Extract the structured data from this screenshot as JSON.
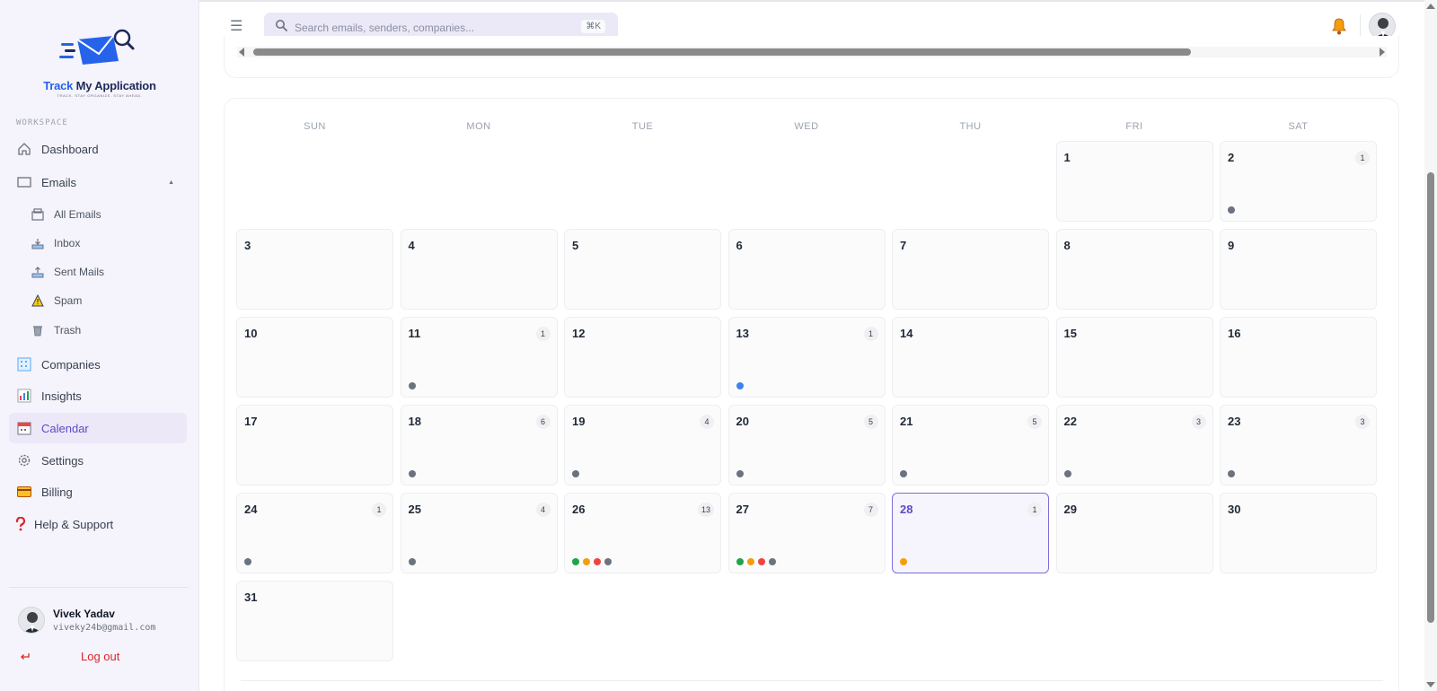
{
  "app": {
    "logo_word_1": "Track",
    "logo_word_2": "My Application",
    "tagline": "TRACK. STAY ORGANIZE. STAY AHEAD."
  },
  "sidebar": {
    "section_label": "WORKSPACE",
    "items": [
      {
        "label": "Dashboard",
        "icon": "home-icon"
      },
      {
        "label": "Emails",
        "icon": "mail-icon"
      },
      {
        "label": "Companies",
        "icon": "building-icon"
      },
      {
        "label": "Insights",
        "icon": "bar-chart-icon"
      },
      {
        "label": "Calendar",
        "icon": "calendar-icon",
        "active": true
      },
      {
        "label": "Settings",
        "icon": "gear-icon"
      },
      {
        "label": "Billing",
        "icon": "credit-card-icon"
      },
      {
        "label": "Help & Support",
        "icon": "question-icon"
      }
    ],
    "email_subitems": [
      {
        "label": "All Emails",
        "icon": "inbox-tray-icon"
      },
      {
        "label": "Inbox",
        "icon": "inbox-icon"
      },
      {
        "label": "Sent Mails",
        "icon": "outbox-icon"
      },
      {
        "label": "Spam",
        "icon": "warning-icon"
      },
      {
        "label": "Trash",
        "icon": "trash-icon"
      }
    ],
    "user": {
      "name": "Vivek Yadav",
      "email": "viveky24b@gmail.com"
    },
    "logout_label": "Log out"
  },
  "header": {
    "search_placeholder": "Search emails, senders, companies...",
    "shortcut": "⌘K"
  },
  "calendar": {
    "weekdays": [
      "SUN",
      "MON",
      "TUE",
      "WED",
      "THU",
      "FRI",
      "SAT"
    ],
    "first_weekday_index": 5,
    "today": 28,
    "days": [
      {
        "day": 1
      },
      {
        "day": 2,
        "count": "1",
        "dots": [
          "#6b7280"
        ]
      },
      {
        "day": 3
      },
      {
        "day": 4
      },
      {
        "day": 5
      },
      {
        "day": 6
      },
      {
        "day": 7
      },
      {
        "day": 8
      },
      {
        "day": 9
      },
      {
        "day": 10
      },
      {
        "day": 11,
        "count": "1",
        "dots": [
          "#6b7280"
        ]
      },
      {
        "day": 12
      },
      {
        "day": 13,
        "count": "1",
        "dots": [
          "#3b82f6"
        ]
      },
      {
        "day": 14
      },
      {
        "day": 15
      },
      {
        "day": 16
      },
      {
        "day": 17
      },
      {
        "day": 18,
        "count": "6",
        "dots": [
          "#6b7280"
        ]
      },
      {
        "day": 19,
        "count": "4",
        "dots": [
          "#6b7280"
        ]
      },
      {
        "day": 20,
        "count": "5",
        "dots": [
          "#6b7280"
        ]
      },
      {
        "day": 21,
        "count": "5",
        "dots": [
          "#6b7280"
        ]
      },
      {
        "day": 22,
        "count": "3",
        "dots": [
          "#6b7280"
        ]
      },
      {
        "day": 23,
        "count": "3",
        "dots": [
          "#6b7280"
        ]
      },
      {
        "day": 24,
        "count": "1",
        "dots": [
          "#6b7280"
        ]
      },
      {
        "day": 25,
        "count": "4",
        "dots": [
          "#6b7280"
        ]
      },
      {
        "day": 26,
        "count": "13",
        "dots": [
          "#22a34a",
          "#f59e0b",
          "#ef4444",
          "#6b7280"
        ]
      },
      {
        "day": 27,
        "count": "7",
        "dots": [
          "#22a34a",
          "#f59e0b",
          "#ef4444",
          "#6b7280"
        ]
      },
      {
        "day": 28,
        "count": "1",
        "dots": [
          "#f59e0b"
        ]
      },
      {
        "day": 29
      },
      {
        "day": 30
      },
      {
        "day": 31
      }
    ]
  },
  "colors": {
    "accent": "#5b4bc4",
    "logout": "#dc2626"
  }
}
